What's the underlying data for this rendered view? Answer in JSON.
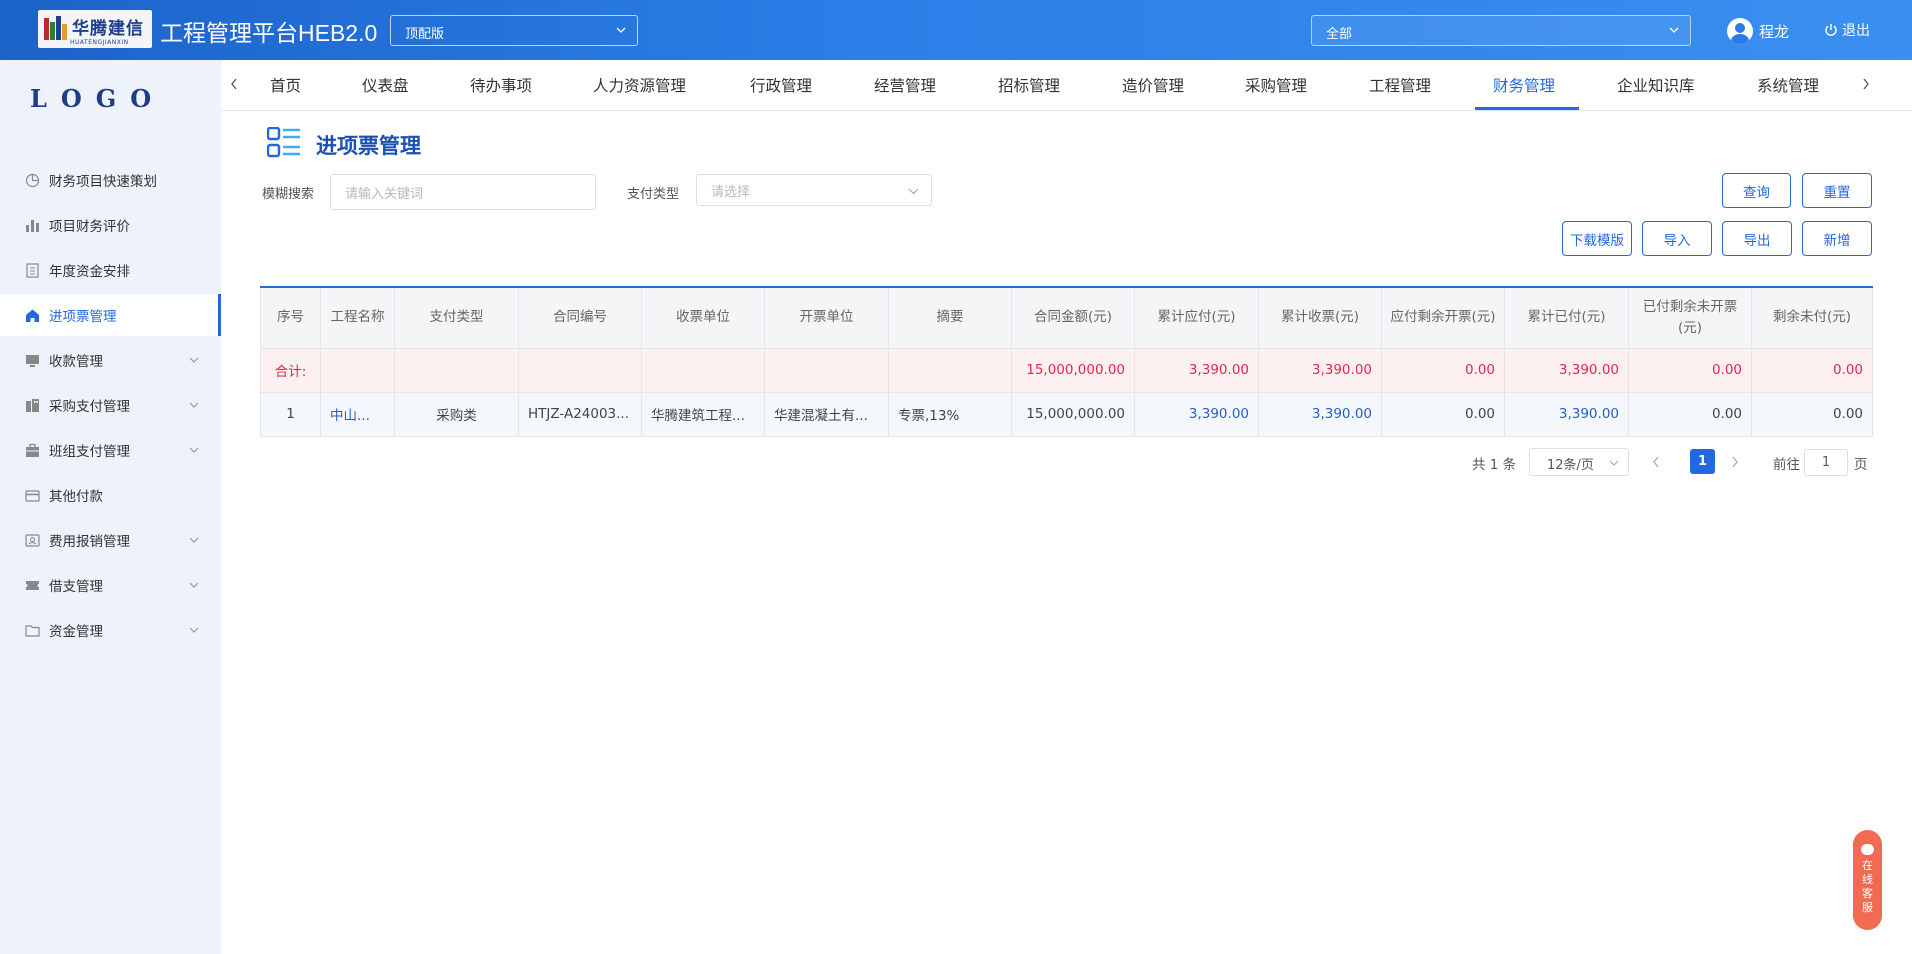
{
  "header": {
    "logo_cn": "华腾建信",
    "logo_en": "HUATENGJIANXIN",
    "app_title": "工程管理平台HEB2.0",
    "version_select": "顶配版",
    "scope_select": "全部",
    "user_name": "程龙",
    "logout_label": "退出"
  },
  "sidebar": {
    "logo": "LOGO",
    "items": [
      {
        "label": "财务项目快速策划",
        "icon": "pie-chart-icon",
        "has_arrow": false,
        "active": false
      },
      {
        "label": "项目财务评价",
        "icon": "bar-chart-icon",
        "has_arrow": false,
        "active": false
      },
      {
        "label": "年度资金安排",
        "icon": "document-list-icon",
        "has_arrow": false,
        "active": false
      },
      {
        "label": "进项票管理",
        "icon": "home-icon",
        "has_arrow": false,
        "active": true
      },
      {
        "label": "收款管理",
        "icon": "monitor-icon",
        "has_arrow": true,
        "active": false
      },
      {
        "label": "采购支付管理",
        "icon": "building-icon",
        "has_arrow": true,
        "active": false
      },
      {
        "label": "班组支付管理",
        "icon": "briefcase-icon",
        "has_arrow": true,
        "active": false
      },
      {
        "label": "其他付款",
        "icon": "card-icon",
        "has_arrow": false,
        "active": false
      },
      {
        "label": "费用报销管理",
        "icon": "id-card-icon",
        "has_arrow": true,
        "active": false
      },
      {
        "label": "借支管理",
        "icon": "ticket-icon",
        "has_arrow": true,
        "active": false
      },
      {
        "label": "资金管理",
        "icon": "folder-icon",
        "has_arrow": true,
        "active": false
      }
    ]
  },
  "nav": {
    "tabs": [
      "首页",
      "仪表盘",
      "待办事项",
      "人力资源管理",
      "行政管理",
      "经营管理",
      "招标管理",
      "造价管理",
      "采购管理",
      "工程管理",
      "财务管理",
      "企业知识库",
      "系统管理"
    ],
    "active_tab": "财务管理"
  },
  "page": {
    "title": "进项票管理",
    "search_label": "模糊搜索",
    "search_placeholder": "请输入关键词",
    "pay_type_label": "支付类型",
    "pay_type_placeholder": "请选择",
    "query_button": "查询",
    "reset_button": "重置",
    "download_template_button": "下载模版",
    "import_button": "导入",
    "export_button": "导出",
    "add_button": "新增"
  },
  "table": {
    "headers": [
      "序号",
      "工程名称",
      "支付类型",
      "合同编号",
      "收票单位",
      "开票单位",
      "摘要",
      "合同金额(元)",
      "累计应付(元)",
      "累计收票(元)",
      "应付剩余开票(元)",
      "累计已付(元)",
      "已付剩余未开票(元)",
      "剩余未付(元)"
    ],
    "summary": {
      "label": "合计:",
      "contract_amount": "15,000,000.00",
      "cumulative_payable": "3,390.00",
      "cumulative_received": "3,390.00",
      "payable_remaining": "0.00",
      "cumulative_paid": "3,390.00",
      "paid_uninvoiced": "0.00",
      "remaining_unpaid": "0.00"
    },
    "rows": [
      {
        "index": "1",
        "project": "中山...",
        "pay_type": "采购类",
        "contract_no": "HTJZ-A24003...",
        "receiver": "华腾建筑工程...",
        "issuer": "华建混凝土有...",
        "summary": "专票,13%",
        "contract_amount": "15,000,000.00",
        "cumulative_payable": "3,390.00",
        "cumulative_received": "3,390.00",
        "payable_remaining": "0.00",
        "cumulative_paid": "3,390.00",
        "paid_uninvoiced": "0.00",
        "remaining_unpaid": "0.00"
      }
    ]
  },
  "pagination": {
    "total": "共 1 条",
    "page_size": "12条/页",
    "current_page": "1",
    "goto_label": "前往",
    "goto_value": "1",
    "page_suffix": "页"
  },
  "service": {
    "chars": [
      "在",
      "线",
      "客",
      "服"
    ]
  },
  "colors": {
    "primary": "#2468e0",
    "header_gradient_start": "#1c63c9",
    "header_gradient_end": "#3a8ff0",
    "summary_red": "#e0294a",
    "service_orange": "#f06b52"
  }
}
